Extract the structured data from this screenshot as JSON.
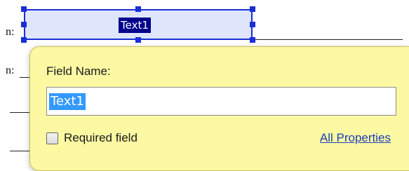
{
  "document": {
    "row_labels": [
      "n:",
      "n:",
      "",
      ""
    ],
    "selected_field": {
      "name": "Text1"
    }
  },
  "popup": {
    "field_name_label": "Field Name:",
    "field_name_value": "Text1",
    "required_label": "Required field",
    "required_checked": false,
    "all_properties_link": "All Properties"
  },
  "colors": {
    "popup_background": "#fdf9a3",
    "selection_border": "#1a2fd6",
    "field_fill": "#dfe6fb",
    "text_selection": "#3399ff",
    "link": "#1a3fb8"
  }
}
